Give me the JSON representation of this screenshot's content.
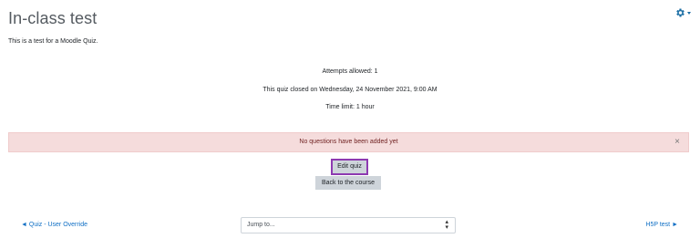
{
  "header": {
    "title": "In-class test",
    "intro": "This is a test for a Moodle Quiz.",
    "settings_icon": "gear-icon",
    "accent_color": "#1d6fa5"
  },
  "quiz_info": {
    "attempts": "Attempts allowed: 1",
    "closed": "This quiz closed on Wednesday, 24 November 2021, 9:00 AM",
    "time_limit": "Time limit: 1 hour"
  },
  "alert": {
    "message": "No questions have been added yet",
    "close_icon": "close-icon",
    "close_glyph": "×",
    "background_color": "#f5dcdc"
  },
  "buttons": {
    "edit_quiz": "Edit quiz",
    "back_to_course": "Back to the course",
    "highlight_color": "#8e3ab1"
  },
  "navigation": {
    "prev_label": "◄ Quiz - User Override",
    "jump_placeholder": "Jump to...",
    "next_label": "H5P test ►",
    "link_color": "#0f6fc5"
  }
}
